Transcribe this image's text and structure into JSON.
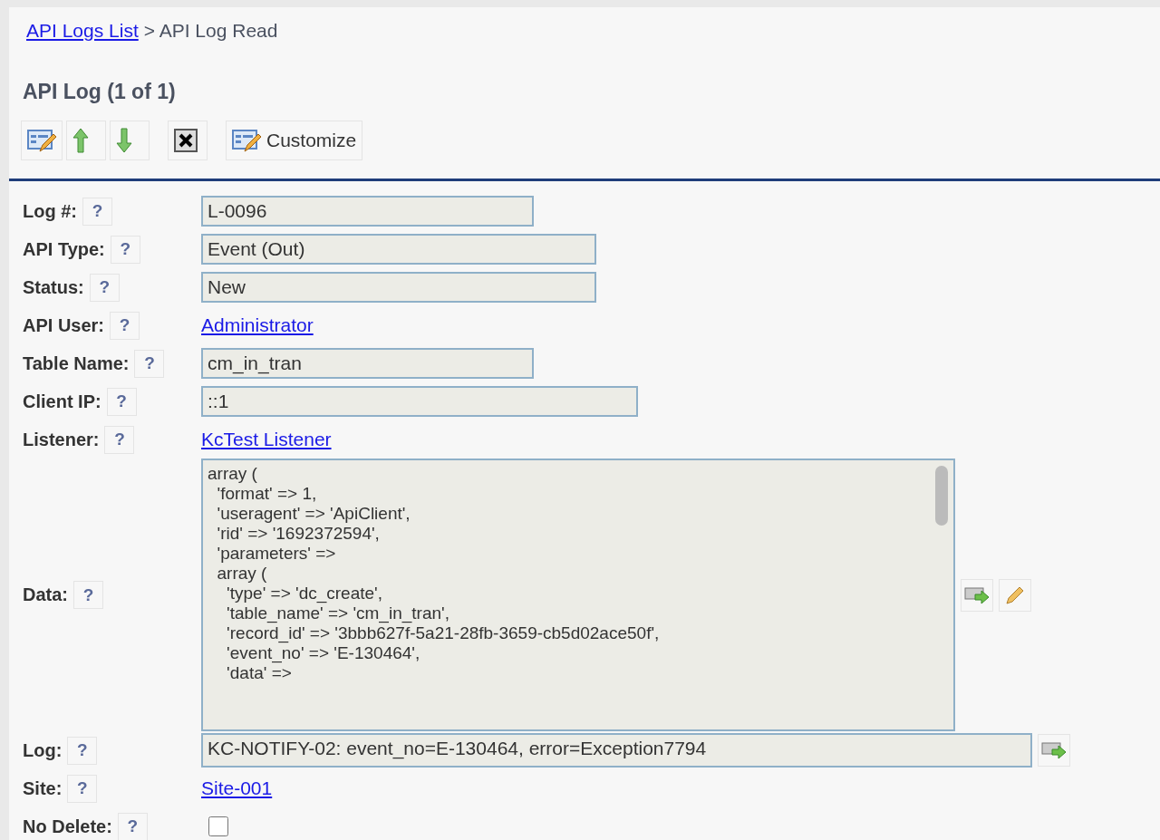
{
  "breadcrumb": {
    "link": "API Logs List",
    "current": "> API Log Read"
  },
  "title": "API Log (1 of 1)",
  "toolbar": [
    {
      "kind": "edit"
    },
    {
      "kind": "up"
    },
    {
      "kind": "down"
    },
    {
      "kind": "delete"
    },
    {
      "kind": "customize",
      "label": "Customize"
    }
  ],
  "fields": [
    {
      "kind": "text",
      "label": "Log #:",
      "help": "?",
      "value": "L-0096"
    },
    {
      "kind": "text",
      "label": "API Type:",
      "help": "?",
      "value": "Event (Out)"
    },
    {
      "kind": "text",
      "label": "Status:",
      "help": "?",
      "value": "New"
    },
    {
      "kind": "link",
      "label": "API User:",
      "help": "?",
      "value": "Administrator"
    },
    {
      "kind": "text",
      "label": "Table Name:",
      "help": "?",
      "value": "cm_in_tran"
    },
    {
      "kind": "text",
      "label": "Client IP:",
      "help": "?",
      "value": "::1"
    },
    {
      "kind": "link",
      "label": "Listener:",
      "help": "?",
      "value": "KcTest Listener"
    },
    {
      "kind": "textarea",
      "label": "Data:",
      "help": "?",
      "value": "array (\n  'format' => 1,\n  'useragent' => 'ApiClient',\n  'rid' => '1692372594',\n  'parameters' =>\n  array (\n    'type' => 'dc_create',\n    'table_name' => 'cm_in_tran',\n    'record_id' => '3bbb627f-5a21-28fb-3659-cb5d02ace50f',\n    'event_no' => 'E-130464',\n    'data' =>"
    },
    {
      "kind": "logline",
      "label": "Log:",
      "help": "?",
      "value": "KC-NOTIFY-02: event_no=E-130464, error=Exception7794"
    },
    {
      "kind": "link",
      "label": "Site:",
      "help": "?",
      "value": "Site-001"
    },
    {
      "kind": "checkbox",
      "label": "No Delete:",
      "help": "?",
      "checked": false
    }
  ]
}
